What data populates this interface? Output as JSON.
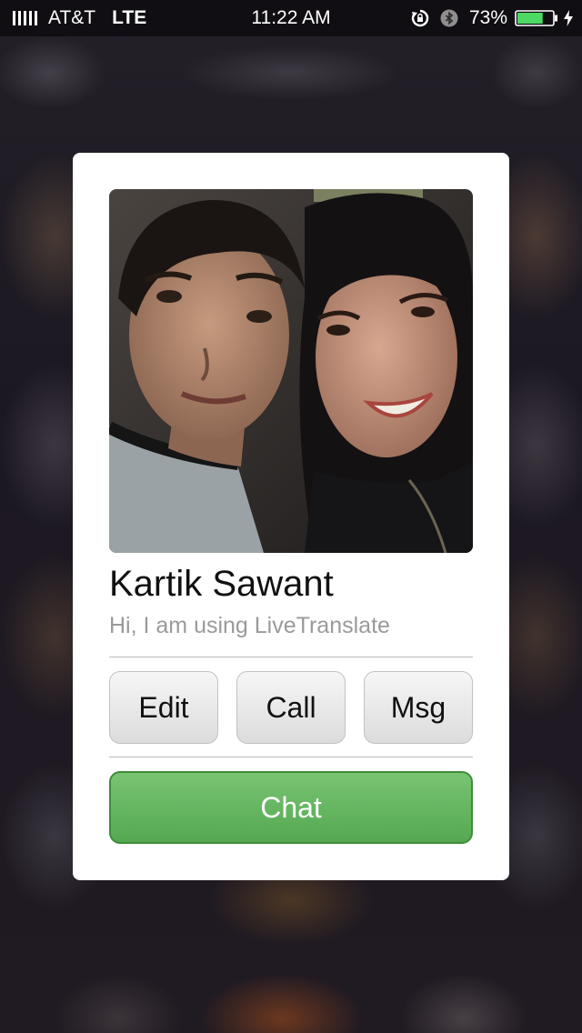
{
  "status_bar": {
    "carrier": "AT&T",
    "network": "LTE",
    "time": "11:22 AM",
    "battery_percent": "73%",
    "battery_level": 0.73,
    "icons": [
      "signal-icon",
      "rotation-lock-icon",
      "bluetooth-icon",
      "battery-icon",
      "charging-bolt-icon"
    ]
  },
  "contact_card": {
    "photo_alt": "contact-photo",
    "name": "Kartik Sawant",
    "status_message": "Hi, I am using LiveTranslate",
    "actions": {
      "edit_label": "Edit",
      "call_label": "Call",
      "msg_label": "Msg"
    },
    "chat_label": "Chat"
  },
  "colors": {
    "chat_button": "#5cae57",
    "card_background": "#ffffff",
    "name_text": "#111111",
    "status_text": "#9a9a9a"
  }
}
